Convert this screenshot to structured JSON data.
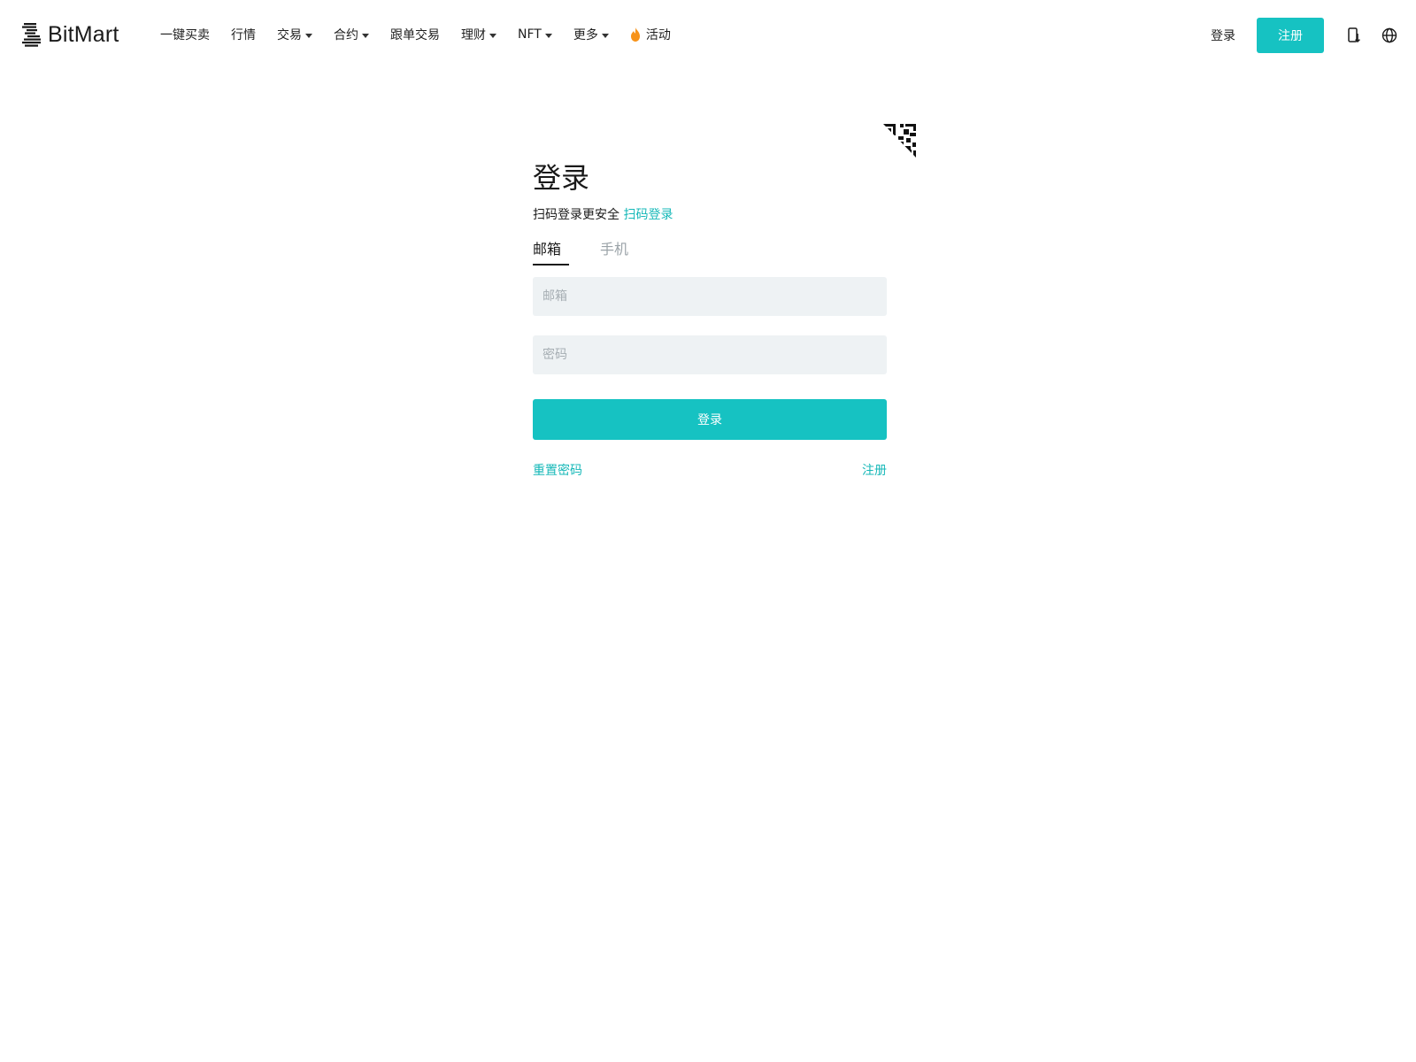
{
  "brand": {
    "name": "BitMart",
    "accent_color": "#16c2c2",
    "logo_icon": "bitmart-logo-icon"
  },
  "nav": {
    "items": [
      {
        "label": "一键买卖",
        "has_dropdown": false
      },
      {
        "label": "行情",
        "has_dropdown": false
      },
      {
        "label": "交易",
        "has_dropdown": true
      },
      {
        "label": "合约",
        "has_dropdown": true
      },
      {
        "label": "跟单交易",
        "has_dropdown": false
      },
      {
        "label": "理财",
        "has_dropdown": true
      },
      {
        "label": "NFT",
        "has_dropdown": true
      },
      {
        "label": "更多",
        "has_dropdown": true
      },
      {
        "label": "活动",
        "has_dropdown": false,
        "icon": "fire-icon"
      }
    ]
  },
  "header_right": {
    "login_label": "登录",
    "register_label": "注册",
    "icons": [
      "download-app-icon",
      "globe-icon"
    ]
  },
  "login": {
    "qr_corner_icon": "qr-code-icon",
    "title": "登录",
    "subtitle_text": "扫码登录更安全",
    "subtitle_link": "扫码登录",
    "tabs": [
      {
        "label": "邮箱",
        "active": true
      },
      {
        "label": "手机",
        "active": false
      }
    ],
    "email_placeholder": "邮箱",
    "password_placeholder": "密码",
    "submit_label": "登录",
    "reset_label": "重置密码",
    "register_label": "注册"
  }
}
